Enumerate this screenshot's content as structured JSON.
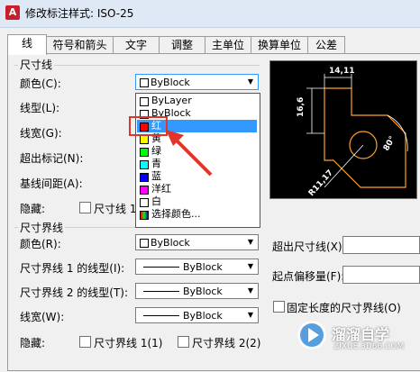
{
  "window": {
    "title": "修改标注样式: ISO-25",
    "app_icon": "A"
  },
  "tabs": [
    "线",
    "符号和箭头",
    "文字",
    "调整",
    "主单位",
    "换算单位",
    "公差"
  ],
  "dim_lines": {
    "group_title": "尺寸线",
    "color_label": "颜色(C):",
    "color_value": "ByBlock",
    "linetype_label": "线型(L):",
    "lineweight_label": "线宽(G):",
    "extend_ticks_label": "超出标记(N):",
    "baseline_spacing_label": "基线间距(A):",
    "suppress_label": "隐藏:",
    "suppress_dim1": "尺寸线 1"
  },
  "color_dropdown": {
    "items": [
      {
        "label": "ByLayer",
        "color": "#ffffff"
      },
      {
        "label": "ByBlock",
        "color": "#ffffff"
      },
      {
        "label": "红",
        "color": "#ff0000"
      },
      {
        "label": "黄",
        "color": "#ffff00"
      },
      {
        "label": "绿",
        "color": "#00ff00"
      },
      {
        "label": "青",
        "color": "#00ffff"
      },
      {
        "label": "蓝",
        "color": "#0000ff"
      },
      {
        "label": "洋红",
        "color": "#ff00ff"
      },
      {
        "label": "白",
        "color": "#ffffff"
      },
      {
        "label": "选择颜色...",
        "color": "multi"
      }
    ],
    "selected_index": 2
  },
  "ext_lines": {
    "group_title": "尺寸界线",
    "color_label": "颜色(R):",
    "color_value": "ByBlock",
    "linetype1_label": "尺寸界线 1 的线型(I):",
    "linetype1_value": "ByBlock",
    "linetype2_label": "尺寸界线 2 的线型(T):",
    "linetype2_value": "ByBlock",
    "lineweight_label": "线宽(W):",
    "lineweight_value": "ByBlock",
    "suppress_label": "隐藏:",
    "suppress_ext1": "尺寸界线 1(1)",
    "suppress_ext2": "尺寸界线 2(2)",
    "extend_beyond_label": "超出尺寸线(X):",
    "offset_label": "起点偏移量(F):",
    "fixed_length_label": "固定长度的尺寸界线(O)"
  },
  "preview": {
    "dim_top": "14,11",
    "dim_left": "16,6",
    "dim_radius": "R11,17",
    "dim_angle": "80°"
  },
  "watermark": {
    "brand": "溜溜自学",
    "url": "ZIXUE.3D66.COM"
  },
  "colors": {
    "annotation_red": "#e0352a",
    "preview_orange": "#ff9f2a",
    "selection_blue": "#3399ff"
  }
}
